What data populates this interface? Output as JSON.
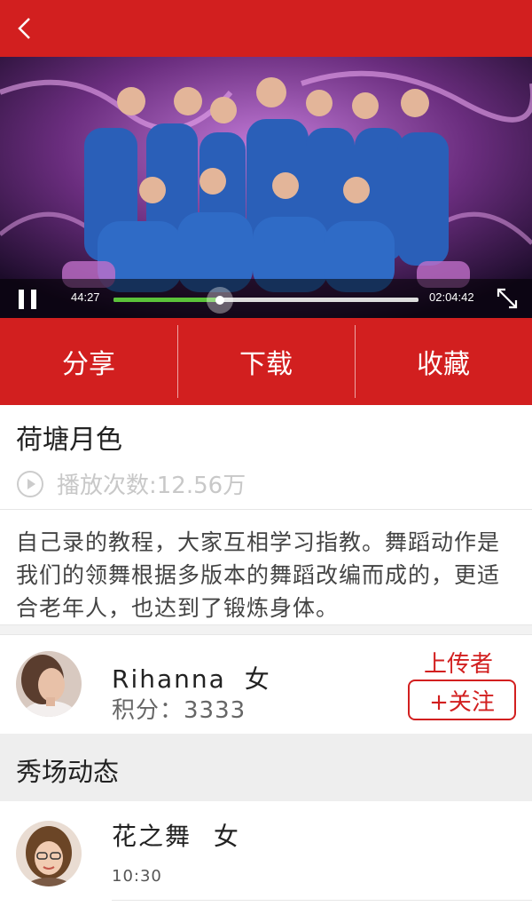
{
  "player": {
    "current_time": "44:27",
    "total_time": "02:04:42",
    "progress": 0.35
  },
  "actions": [
    "分享",
    "下载",
    "收藏"
  ],
  "video": {
    "title": "荷塘月色",
    "play_count": "播放次数:12.56万",
    "description": "自己录的教程，大家互相学习指教。舞蹈动作是我们的领舞根据多版本的舞蹈改编而成的，更适合老年人，也达到了锻炼身体。"
  },
  "uploader": {
    "name": "Rihanna",
    "gender": "女",
    "score": "积分：3333",
    "role": "上传者",
    "follow_label": "+关注"
  },
  "feed": {
    "section_title": "秀场动态",
    "items": [
      {
        "name": "花之舞",
        "gender": "女",
        "time": "10:30"
      }
    ]
  },
  "colors": {
    "brand_red": "#d21f1f",
    "progress_green": "#5bc23a"
  },
  "icons": [
    "back-icon",
    "pause-icon",
    "fullscreen-icon",
    "play-count-icon"
  ]
}
